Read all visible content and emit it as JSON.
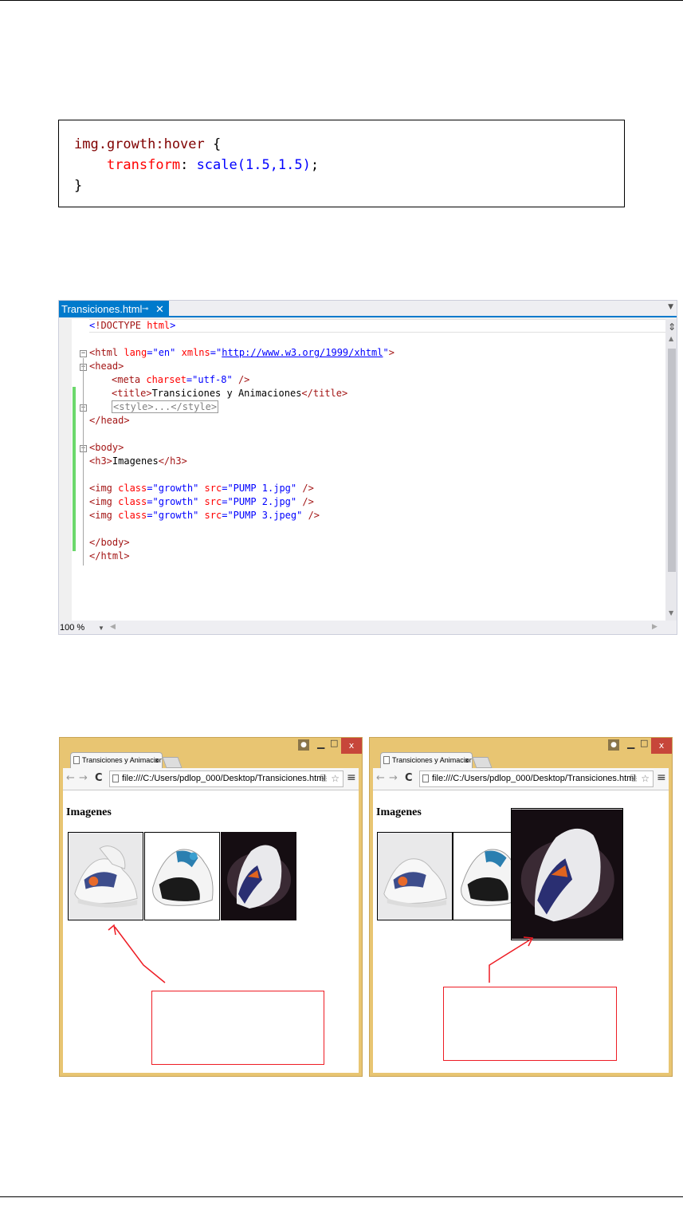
{
  "css_snippet": {
    "selector": "img.growth:hover",
    "open_brace": " {",
    "property": "transform",
    "colon": ": ",
    "value": "scale(1.5,1.5)",
    "semicolon": ";",
    "close_brace": "}"
  },
  "ide": {
    "tab_title": "Transiciones.html",
    "pin_glyph": "⊸",
    "close_glyph": "✕",
    "dropdown_glyph": "▼",
    "zoom_level": "100 %",
    "code": {
      "l1_a": "<",
      "l1_b": "!DOCTYPE",
      "l1_c": " html",
      "l1_d": ">",
      "l3_tag": "<html",
      "l3_attr1": " lang",
      "l3_eq1": "=",
      "l3_val1": "\"en\"",
      "l3_attr2": " xmlns",
      "l3_eq2": "=",
      "l3_q1": "\"",
      "l3_url": "http://www.w3.org/1999/xhtml",
      "l3_q2": "\"",
      "l3_end": ">",
      "l4": "<head>",
      "l5_tag": "<meta",
      "l5_attr": " charset",
      "l5_eq": "=",
      "l5_val": "\"utf-8\"",
      "l5_end": " />",
      "l6_open": "<title>",
      "l6_text": "Transiciones y Animaciones",
      "l6_close": "</title>",
      "l7": "<style>...</style>",
      "l8": "</head>",
      "l10": "<body>",
      "l11_open": "<h3>",
      "l11_text": "Imagenes",
      "l11_close": "</h3>",
      "img_tag": "<img",
      "img_class_attr": " class",
      "img_eq": "=",
      "img_class_val": "\"growth\"",
      "img_src_attr": " src",
      "img_src1": "\"PUMP 1.jpg\"",
      "img_src2": "\"PUMP 2.jpg\"",
      "img_src3": "\"PUMP 3.jpeg\"",
      "img_end": " />",
      "l17": "</body>",
      "l18": "</html>"
    }
  },
  "browsers": [
    {
      "tab_title": "Transiciones y Animacion",
      "url": "file:///C:/Users/pdlop_000/Desktop/Transiciones.html",
      "heading": "Imagenes",
      "hovered_image_index": 0
    },
    {
      "tab_title": "Transiciones y Animacion",
      "url": "file:///C:/Users/pdlop_000/Desktop/Transiciones.html",
      "heading": "Imagenes",
      "hovered_image_index": 3
    }
  ],
  "colors": {
    "css_selector": "#800000",
    "css_property": "#ff0000",
    "css_value": "#0000ff",
    "ide_accent": "#007acc",
    "change_bar": "#6cd86c",
    "browser_frame": "#e8c572",
    "close_button": "#c7463a",
    "callout": "#ee1c24"
  }
}
